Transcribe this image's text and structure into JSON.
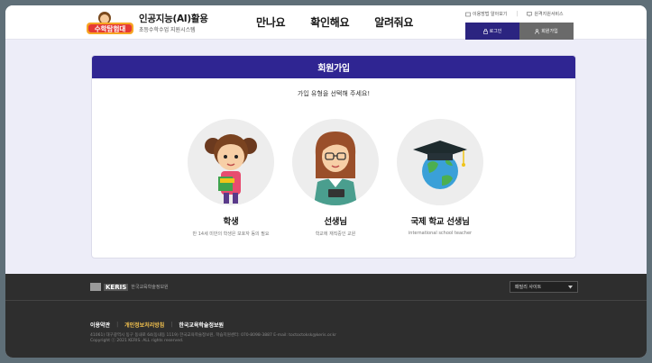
{
  "header": {
    "logo_badge": "수학탐험대",
    "logo_title": "인공지능(AI)활용",
    "logo_subtitle": "초등수학수업 지원시스템",
    "nav": [
      "만나요",
      "확인해요",
      "알려줘요"
    ],
    "util_links": [
      "이용방법 알아보기",
      "원격지원서비스"
    ],
    "login_label": "로그인",
    "join_label": "회원가입"
  },
  "signup": {
    "title": "회원가입",
    "instruction": "가입 유형을 선택해 주세요!",
    "options": [
      {
        "name": "학생",
        "desc": "만 14세 미만의 학생은 보호자 동의 필요"
      },
      {
        "name": "선생님",
        "desc": "학교에 재직중인 교원"
      },
      {
        "name": "국제 학교 선생님",
        "desc": "international school teacher"
      }
    ]
  },
  "footer": {
    "brand": "KERIS",
    "org_name": "한국교육학술정보원",
    "family_site_label": "패밀리 사이트",
    "links": [
      "이용약관",
      "개인정보처리방침",
      "한국교육학술정보원"
    ],
    "address": "41061) 대구광역시 동구 동내로 64(동내동 1119) 한국교육학술정보원, 학습지원센터: 070-8098-3887 E-mail: toctoctoksk@keris.or.kr",
    "copyright": "Copyright ⓒ 2021 KERIS. ALL rights reserved."
  },
  "colors": {
    "primary": "#2f2592",
    "page_bg": "#ededf8",
    "footer_bg": "#2e2e2e",
    "highlight": "#f2c14e"
  }
}
